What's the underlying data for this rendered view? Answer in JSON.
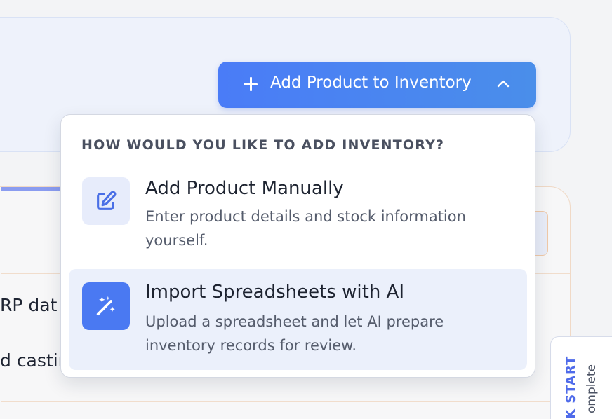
{
  "background": {
    "row_1_text": "RP dat",
    "row_2_text": "d castin"
  },
  "primary_button": {
    "label": "Add Product to Inventory",
    "icon": "plus-icon",
    "toggle_icon": "chevron-up-icon"
  },
  "menu": {
    "heading": "HOW WOULD YOU LIKE TO ADD INVENTORY?",
    "items": [
      {
        "title": "Add Product Manually",
        "description": "Enter product details and stock information yourself.",
        "icon": "edit-icon"
      },
      {
        "title": "Import Spreadsheets with AI",
        "description": "Upload a spreadsheet and let AI prepare inventory records for review.",
        "icon": "magic-wand-icon"
      }
    ]
  },
  "quick_start": {
    "title": "K START",
    "subtitle": "omplete"
  },
  "colors": {
    "accent": "#4a7cf7",
    "menu_highlight": "#ebf0fb"
  }
}
